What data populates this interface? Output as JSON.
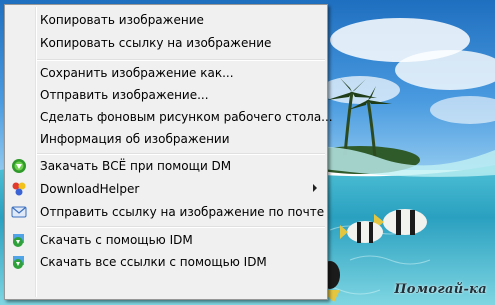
{
  "menu": {
    "items": [
      {
        "label": "Копировать изображение"
      },
      {
        "label": "Копировать ссылку на изображение"
      },
      {
        "label": "Сохранить изображение как..."
      },
      {
        "label": "Отправить изображение..."
      },
      {
        "label": "Сделать фоновым рисунком рабочего стола..."
      },
      {
        "label": "Информация об изображении"
      },
      {
        "label": "Закачать ВСЁ при помощи DM",
        "icon": "download-manager-icon"
      },
      {
        "label": "DownloadHelper",
        "icon": "downloadhelper-icon",
        "submenu": true
      },
      {
        "label": "Отправить ссылку на изображение по почте",
        "icon": "mail-icon"
      },
      {
        "label": "Скачать с помощью IDM",
        "icon": "idm-icon"
      },
      {
        "label": "Скачать все ссылки с помощью IDM",
        "icon": "idm-icon"
      }
    ]
  },
  "watermark": "Помогай-ка",
  "colors": {
    "menu_bg": "#f0f0f0",
    "menu_border": "#979797",
    "sky": "#3f8fd6",
    "water": "#3fb8cf"
  }
}
